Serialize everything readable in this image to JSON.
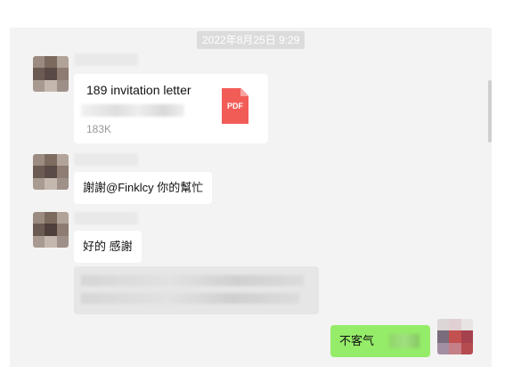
{
  "chat": {
    "timestamp": "2022年8月25日 9:29",
    "messages": {
      "file": {
        "name": "189 invitation letter",
        "size": "183K",
        "icon": "pdf-icon",
        "icon_label": "PDF"
      },
      "msg1": {
        "text": "謝謝@Finklcy  你的幫忙"
      },
      "msg2": {
        "text": "好的 感謝"
      },
      "self": {
        "text": "不客气"
      }
    }
  },
  "colors": {
    "self_bubble": "#95ec69",
    "pdf_red": "#f25c57",
    "panel_bg": "#f3f3f3"
  }
}
